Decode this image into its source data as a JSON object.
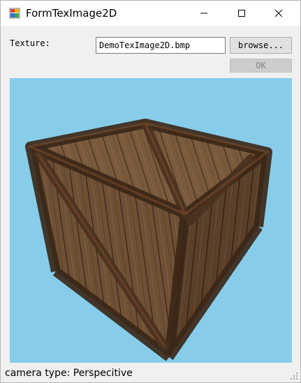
{
  "window": {
    "title": "FormTexImage2D",
    "icon": "windows-form-icon",
    "controls": [
      "minimize-icon",
      "maximize-icon",
      "close-icon"
    ]
  },
  "form": {
    "texture_label": "Texture:",
    "texture_value": "DemoTexImage2D.bmp",
    "browse_label": "browse...",
    "ok_label": "OK",
    "ok_enabled": false
  },
  "viewport": {
    "background_color": "#87CDEA",
    "content": "textured-wooden-crate-cube"
  },
  "status": {
    "text": "camera type: Perspecitive"
  }
}
